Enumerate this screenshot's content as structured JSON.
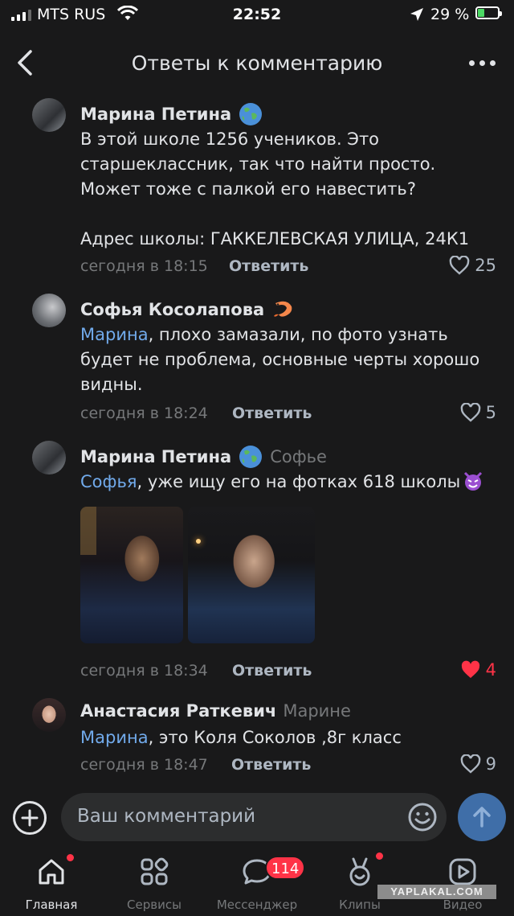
{
  "status_bar": {
    "carrier": "MTS RUS",
    "time": "22:52",
    "battery": "29 %"
  },
  "header": {
    "title": "Ответы к комментарию"
  },
  "comments": [
    {
      "author": "Марина Петина",
      "reply_to": "",
      "mention": "",
      "text": "В этой школе 1256 учеников. Это старшеклассник, так что найти просто. Может тоже с палкой его навестить?\n\nАдрес школы: ГАККЕЛЕВСКАЯ УЛИЦА, 24К1",
      "time": "сегодня в 18:15",
      "reply_label": "Ответить",
      "likes": "25",
      "liked": false
    },
    {
      "author": "Софья Косолапова",
      "reply_to": "",
      "mention": "Марина",
      "text": ", плохо замазали, по фото узнать будет не проблема, основные черты хорошо видны.",
      "time": "сегодня в 18:24",
      "reply_label": "Ответить",
      "likes": "5",
      "liked": false
    },
    {
      "author": "Марина Петина",
      "reply_to": "Софье",
      "mention": "Софья",
      "text": ", уже ищу его на фотках 618 школы",
      "time": "сегодня в 18:34",
      "reply_label": "Ответить",
      "likes": "4",
      "liked": true
    },
    {
      "author": "Анастасия Раткевич",
      "reply_to": "Марине",
      "mention": "Марина",
      "text": ", это Коля Соколов ,8г класс",
      "time": "сегодня в 18:47",
      "reply_label": "Ответить",
      "likes": "9",
      "liked": false
    }
  ],
  "composer": {
    "placeholder": "Ваш комментарий"
  },
  "tabbar": {
    "items": [
      {
        "label": "Главная",
        "icon": "home-icon",
        "active": true
      },
      {
        "label": "Сервисы",
        "icon": "services-icon",
        "active": false
      },
      {
        "label": "Мессенджер",
        "icon": "messenger-icon",
        "active": false,
        "badge": "114"
      },
      {
        "label": "Клипы",
        "icon": "clips-icon",
        "active": false
      },
      {
        "label": "Видео",
        "icon": "video-icon",
        "active": false
      }
    ]
  },
  "watermark": "YAPLAKAL.COM",
  "colors": {
    "background": "#19191a",
    "mention": "#71aaeb",
    "like_active": "#ff3347",
    "send_button": "#3f6ea8"
  }
}
